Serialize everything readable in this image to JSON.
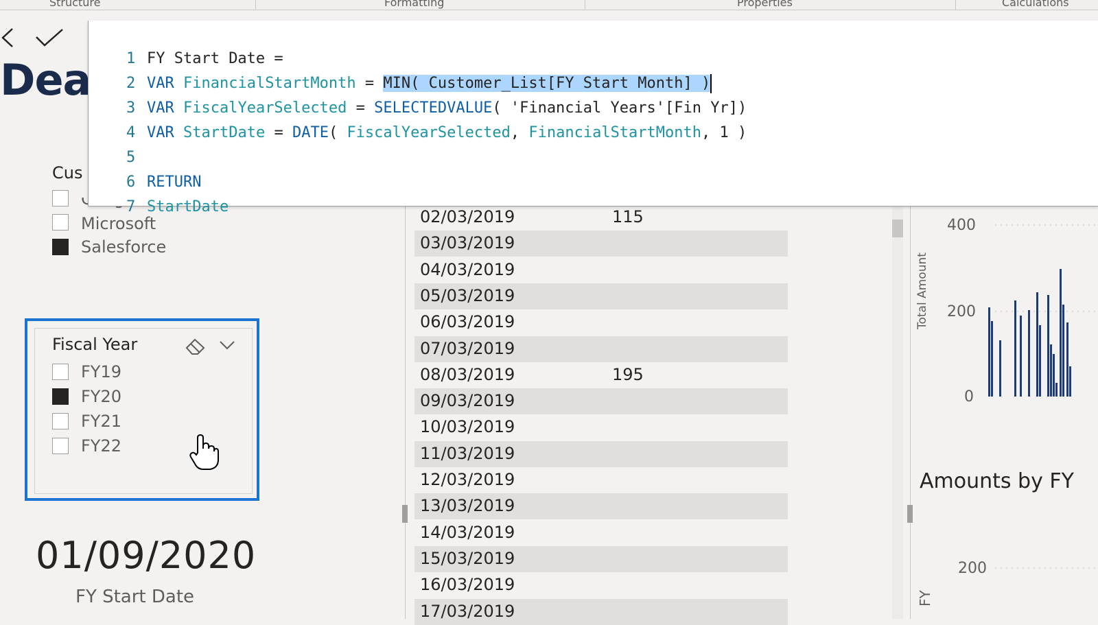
{
  "ribbon": {
    "sections": [
      "Structure",
      "Formatting",
      "Properties",
      "Calculations"
    ]
  },
  "formula_bar": {
    "cancel_icon": "close-icon",
    "commit_icon": "checkmark-icon",
    "lines": [
      {
        "num": "1",
        "text": "FY Start Date ="
      },
      {
        "num": "2",
        "kw": "VAR",
        "var": "FinancialStartMonth",
        "eq": " = ",
        "sel": "MIN( Customer_List[FY Start Month] )"
      },
      {
        "num": "3",
        "kw": "VAR",
        "var": "FiscalYearSelected",
        "eq": " = ",
        "fn": "SELECTEDVALUE",
        "rest": "( 'Financial Years'[Fin Yr])"
      },
      {
        "num": "4",
        "kw": "VAR",
        "var": "StartDate",
        "eq": " = ",
        "fn": "DATE",
        "p1": "( ",
        "a1": "FiscalYearSelected",
        "c1": ", ",
        "a2": "FinancialStartMonth",
        "rest": ", 1 )"
      },
      {
        "num": "5",
        "text": ""
      },
      {
        "num": "6",
        "kw": "RETURN"
      },
      {
        "num": "7",
        "var": "StartDate"
      }
    ]
  },
  "report": {
    "title_fragment": "Dea",
    "customer_slicer": {
      "label": "Cus",
      "items": [
        {
          "label": "Google Inc",
          "checked": false
        },
        {
          "label": "Microsoft",
          "checked": false
        },
        {
          "label": "Salesforce",
          "checked": true
        }
      ]
    },
    "fiscal_slicer": {
      "title": "Fiscal Year",
      "eraser_icon": "eraser-icon",
      "chevron_icon": "chevron-down-icon",
      "items": [
        {
          "label": "FY19",
          "checked": false
        },
        {
          "label": "FY20",
          "checked": true
        },
        {
          "label": "FY21",
          "checked": false
        },
        {
          "label": "FY22",
          "checked": false
        }
      ]
    },
    "card": {
      "value": "01/09/2020",
      "label": "FY Start Date"
    },
    "table": {
      "rows": [
        {
          "date": "02/03/2019",
          "value": "115"
        },
        {
          "date": "03/03/2019",
          "value": ""
        },
        {
          "date": "04/03/2019",
          "value": ""
        },
        {
          "date": "05/03/2019",
          "value": ""
        },
        {
          "date": "06/03/2019",
          "value": ""
        },
        {
          "date": "07/03/2019",
          "value": ""
        },
        {
          "date": "08/03/2019",
          "value": "195"
        },
        {
          "date": "09/03/2019",
          "value": ""
        },
        {
          "date": "10/03/2019",
          "value": ""
        },
        {
          "date": "11/03/2019",
          "value": ""
        },
        {
          "date": "12/03/2019",
          "value": ""
        },
        {
          "date": "13/03/2019",
          "value": ""
        },
        {
          "date": "14/03/2019",
          "value": ""
        },
        {
          "date": "15/03/2019",
          "value": ""
        },
        {
          "date": "16/03/2019",
          "value": ""
        },
        {
          "date": "17/03/2019",
          "value": ""
        }
      ]
    },
    "charts": {
      "top_ticks": [
        "400",
        "200",
        "0"
      ],
      "top_ylabel": "Total Amount",
      "bottom_title": "Amounts by FY",
      "bottom_ticks": [
        "200"
      ],
      "bottom_ylabel": "FY"
    }
  }
}
